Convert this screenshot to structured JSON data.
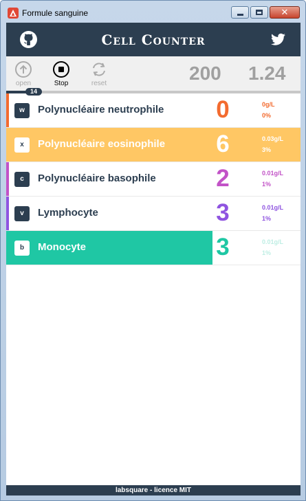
{
  "window": {
    "title": "Formule sanguine",
    "close_glyph": "✕"
  },
  "header": {
    "title": "Cell Counter",
    "github_icon": "github-icon",
    "twitter_icon": "twitter-icon"
  },
  "toolbar": {
    "open_label": "open",
    "stop_label": "Stop",
    "reset_label": "reset",
    "total": "200",
    "ratio": "1.24"
  },
  "progress": {
    "count": "14",
    "fraction": 0.07
  },
  "cells": [
    {
      "key": "w",
      "name": "Polynucléaire neutrophile",
      "count": "0",
      "conc": "0g/L",
      "pct": "0%",
      "color": "#f36b2f",
      "filled": false
    },
    {
      "key": "x",
      "name": "Polynucléaire eosinophile",
      "count": "6",
      "conc": "0.03g/L",
      "pct": "3%",
      "color": "#ffc764",
      "filled": true,
      "fill_fraction": 1.0
    },
    {
      "key": "c",
      "name": "Polynucléaire basophile",
      "count": "2",
      "conc": "0.01g/L",
      "pct": "1%",
      "color": "#c253c7",
      "filled": false
    },
    {
      "key": "v",
      "name": "Lymphocyte",
      "count": "3",
      "conc": "0.01g/L",
      "pct": "1%",
      "color": "#8f54e0",
      "filled": false
    },
    {
      "key": "b",
      "name": "Monocyte",
      "count": "3",
      "conc": "0.01g/L",
      "pct": "1%",
      "color": "#1fc7a4",
      "filled": true,
      "fill_fraction": 0.7
    }
  ],
  "footer": {
    "text": "labsquare - licence MIT"
  }
}
